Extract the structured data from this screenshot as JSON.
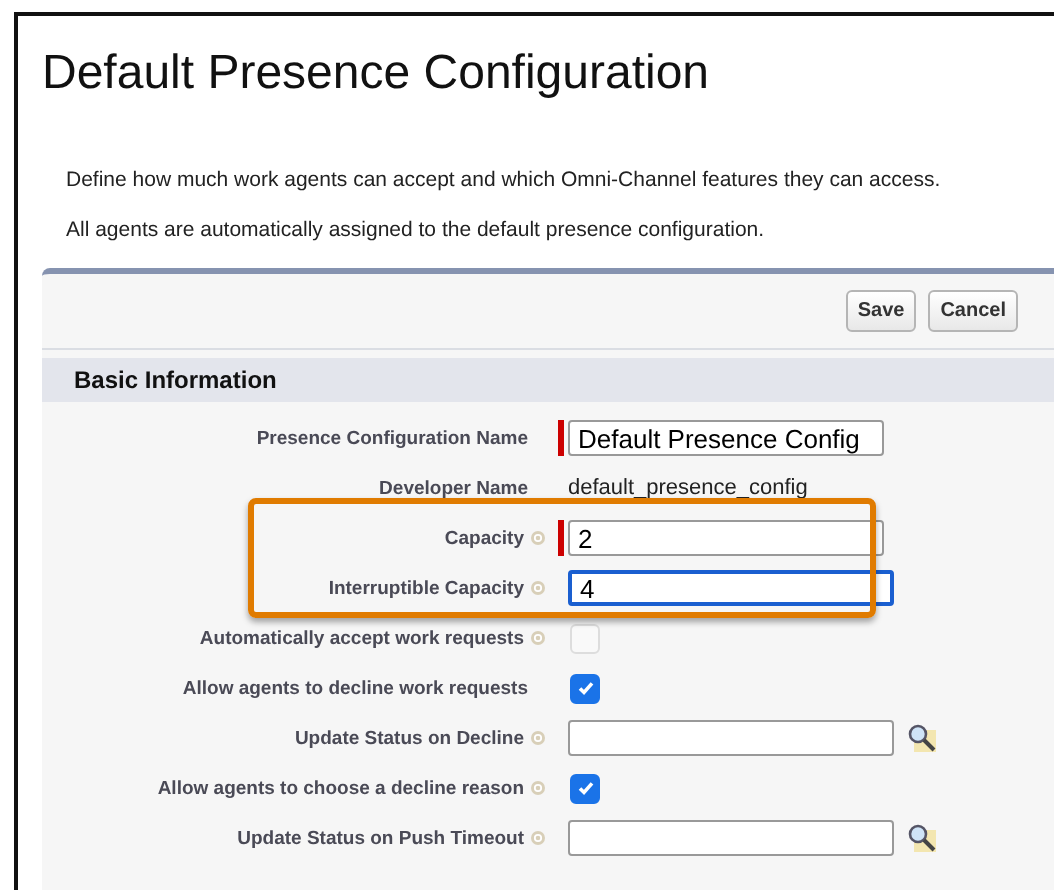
{
  "title": "Default Presence Configuration",
  "intro": [
    "Define how much work agents can accept and which Omni-Channel features they can access.",
    "All agents are automatically assigned to the default presence configuration."
  ],
  "buttons": [
    "Save",
    "Cancel"
  ],
  "section": "Basic Information",
  "rows": [
    {
      "kind": "input",
      "label": "Presence Configuration Name",
      "help": false,
      "required": true,
      "focused": false,
      "highlighted": false,
      "value": "Default Presence Config"
    },
    {
      "kind": "text",
      "label": "Developer Name",
      "help": false,
      "highlighted": false,
      "value": "default_presence_config"
    },
    {
      "kind": "input",
      "label": "Capacity",
      "help": true,
      "required": true,
      "focused": false,
      "highlighted": true,
      "value": "2"
    },
    {
      "kind": "input",
      "label": "Interruptible Capacity",
      "help": true,
      "required": false,
      "focused": true,
      "highlighted": true,
      "value": "4"
    },
    {
      "kind": "checkbox",
      "label": "Automatically accept work requests",
      "help": true,
      "checked": false,
      "disabled": true,
      "highlighted": false
    },
    {
      "kind": "checkbox",
      "label": "Allow agents to decline work requests",
      "help": false,
      "checked": true,
      "disabled": false,
      "highlighted": false
    },
    {
      "kind": "lookup",
      "label": "Update Status on Decline",
      "help": true,
      "highlighted": false
    },
    {
      "kind": "checkbox",
      "label": "Allow agents to choose a decline reason",
      "help": true,
      "checked": true,
      "disabled": false,
      "highlighted": false
    },
    {
      "kind": "lookup",
      "label": "Update Status on Push Timeout",
      "help": true,
      "highlighted": false
    }
  ]
}
